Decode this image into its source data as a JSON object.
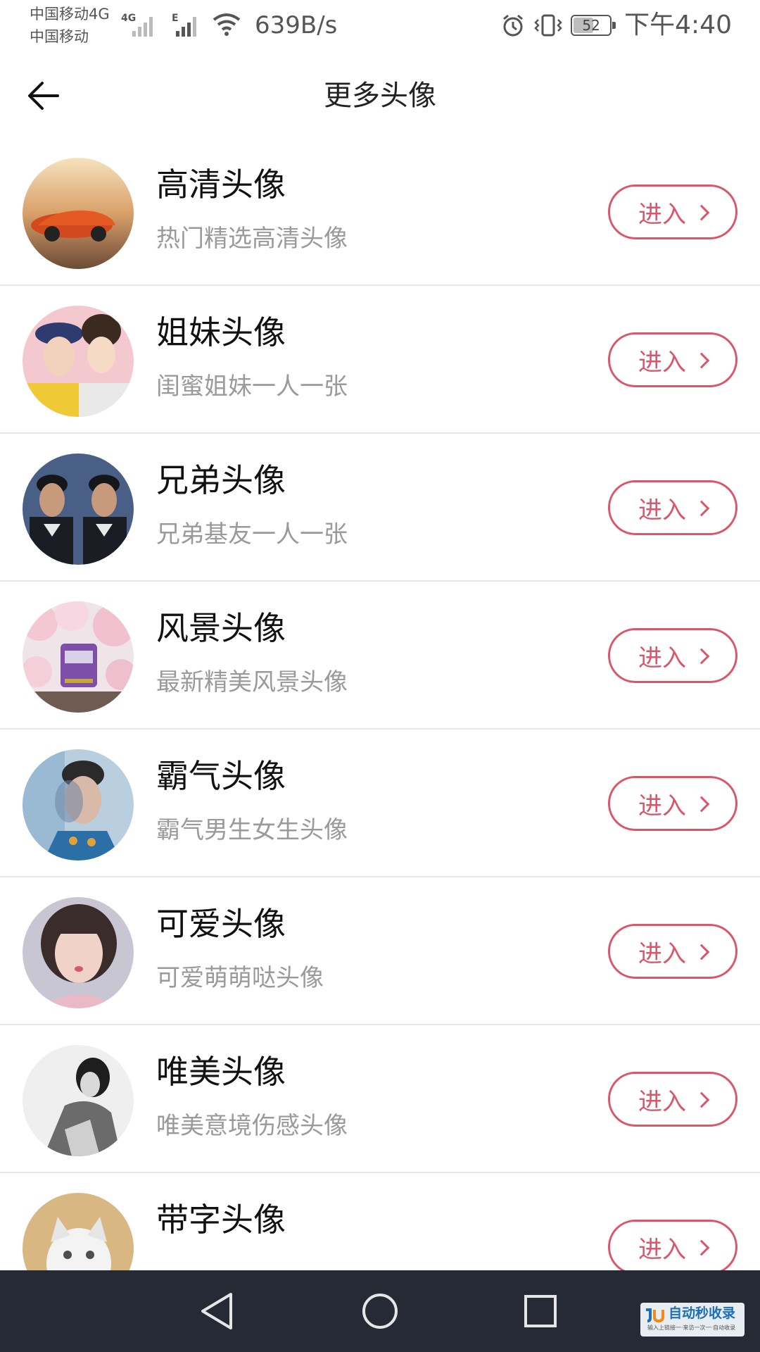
{
  "status_bar": {
    "carrier_1": "中国移动4G",
    "carrier_2": "中国移动",
    "net_speed": "639B/s",
    "battery": "52",
    "time": "下午4:40"
  },
  "header": {
    "title": "更多头像",
    "back_icon": "arrow-left-icon"
  },
  "accent_color": "#d9566b",
  "list": {
    "items": [
      {
        "title": "高清头像",
        "subtitle": "热门精选高清头像",
        "button": "进入"
      },
      {
        "title": "姐妹头像",
        "subtitle": "闺蜜姐妹一人一张",
        "button": "进入"
      },
      {
        "title": "兄弟头像",
        "subtitle": "兄弟基友一人一张",
        "button": "进入"
      },
      {
        "title": "风景头像",
        "subtitle": "最新精美风景头像",
        "button": "进入"
      },
      {
        "title": "霸气头像",
        "subtitle": "霸气男生女生头像",
        "button": "进入"
      },
      {
        "title": "可爱头像",
        "subtitle": "可爱萌萌哒头像",
        "button": "进入"
      },
      {
        "title": "唯美头像",
        "subtitle": "唯美意境伤感头像",
        "button": "进入"
      },
      {
        "title": "带字头像",
        "subtitle": "",
        "button": "进入"
      }
    ]
  },
  "nav_bar": {
    "icons": [
      "triangle-back-icon",
      "circle-home-icon",
      "square-recents-icon"
    ]
  },
  "watermark": {
    "main": "自动秒收录",
    "sub": "输入上链接一·来访一次一·自动收录"
  }
}
